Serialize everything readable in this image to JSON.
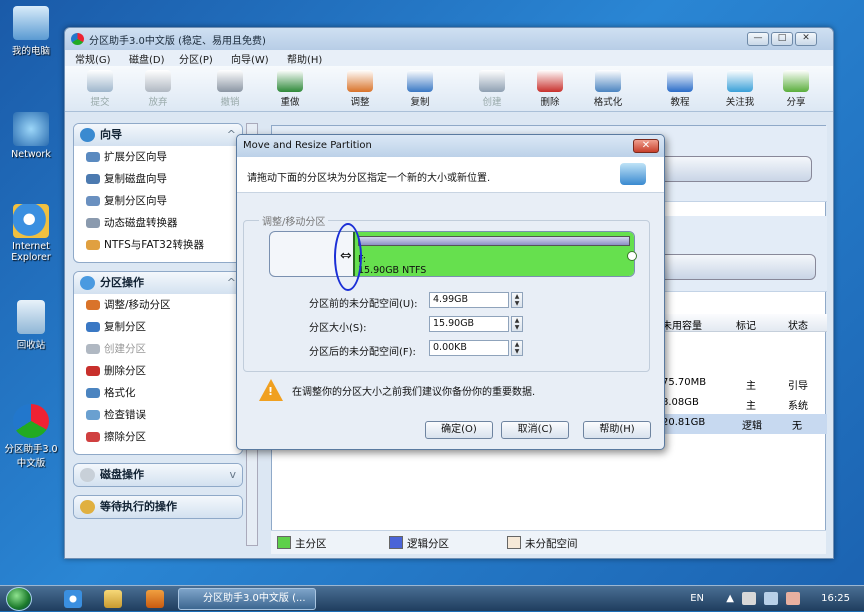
{
  "desktop": {
    "icons": [
      "我的电脑",
      "Network",
      "Internet Explorer",
      "回收站",
      "分区助手3.0中文版"
    ]
  },
  "window": {
    "title": "分区助手3.0中文版 (稳定、易用且免费)",
    "controls": [
      "—",
      "□",
      "✕"
    ]
  },
  "menu": [
    "常规(G)",
    "磁盘(D)",
    "分区(P)",
    "向导(W)",
    "帮助(H)"
  ],
  "toolbar": [
    {
      "label": "提交",
      "enabled": false,
      "color": "#9fb6cc"
    },
    {
      "label": "放弃",
      "enabled": false,
      "color": "#b0b8c2"
    },
    {
      "label": "撤销",
      "enabled": false,
      "color": "#8b96a4"
    },
    {
      "label": "重做",
      "enabled": true,
      "color": "#2f8a3a"
    },
    {
      "label": "调整",
      "enabled": true,
      "color": "#d9732a"
    },
    {
      "label": "复制",
      "enabled": true,
      "color": "#3a78c4"
    },
    {
      "label": "创建",
      "enabled": false,
      "color": "#8fa0b2"
    },
    {
      "label": "删除",
      "enabled": true,
      "color": "#c8302c"
    },
    {
      "label": "格式化",
      "enabled": true,
      "color": "#4b84c0"
    },
    {
      "label": "教程",
      "enabled": true,
      "color": "#2a6cc8"
    },
    {
      "label": "关注我",
      "enabled": true,
      "color": "#3aa0d8"
    },
    {
      "label": "分享",
      "enabled": true,
      "color": "#5aae3c"
    }
  ],
  "panels": {
    "wizard": {
      "title": "向导",
      "items": [
        "扩展分区向导",
        "复制磁盘向导",
        "复制分区向导",
        "动态磁盘转换器",
        "NTFS与FAT32转换器"
      ]
    },
    "partition_ops": {
      "title": "分区操作",
      "items": [
        {
          "label": "调整/移动分区",
          "enabled": true
        },
        {
          "label": "复制分区",
          "enabled": true
        },
        {
          "label": "创建分区",
          "enabled": false
        },
        {
          "label": "删除分区",
          "enabled": true
        },
        {
          "label": "格式化",
          "enabled": true
        },
        {
          "label": "检查错误",
          "enabled": true
        },
        {
          "label": "擦除分区",
          "enabled": true
        }
      ]
    },
    "disk_ops": {
      "title": "磁盘操作"
    },
    "pending": {
      "title": "等待执行的操作"
    }
  },
  "table": {
    "headers": [
      "未用容量",
      "标记",
      "状态"
    ],
    "rows": [
      {
        "free": "75.70MB",
        "type": "主",
        "status": "引导",
        "selected": false
      },
      {
        "free": "8.08GB",
        "type": "主",
        "status": "系统",
        "selected": false
      },
      {
        "free": "20.81GB",
        "type": "逻辑",
        "status": "无",
        "selected": true
      }
    ]
  },
  "legend": [
    {
      "label": "主分区",
      "color": "#5ed04a"
    },
    {
      "label": "逻辑分区",
      "color": "#4a64d8"
    },
    {
      "label": "未分配空间",
      "color": "#f6e9d8"
    }
  ],
  "dialog": {
    "title": "Move and Resize Partition",
    "close": "✕",
    "instruction": "请拖动下面的分区块为分区指定一个新的大小或新位置.",
    "group_label": "调整/移动分区",
    "partition_drive": "F:",
    "partition_text": "15.90GB NTFS",
    "handle_glyph": "⇔",
    "fields": [
      {
        "label": "分区前的未分配空间(U):",
        "value": "4.99GB"
      },
      {
        "label": "分区大小(S):",
        "value": "15.90GB"
      },
      {
        "label": "分区后的未分配空间(F):",
        "value": "0.00KB"
      }
    ],
    "warning": "在调整你的分区大小之前我们建议你备份你的重要数据.",
    "buttons": [
      "确定(O)",
      "取消(C)",
      "帮助(H)"
    ]
  },
  "taskbar": {
    "task": "分区助手3.0中文版 (...",
    "lang": "EN",
    "time": "16:25"
  }
}
